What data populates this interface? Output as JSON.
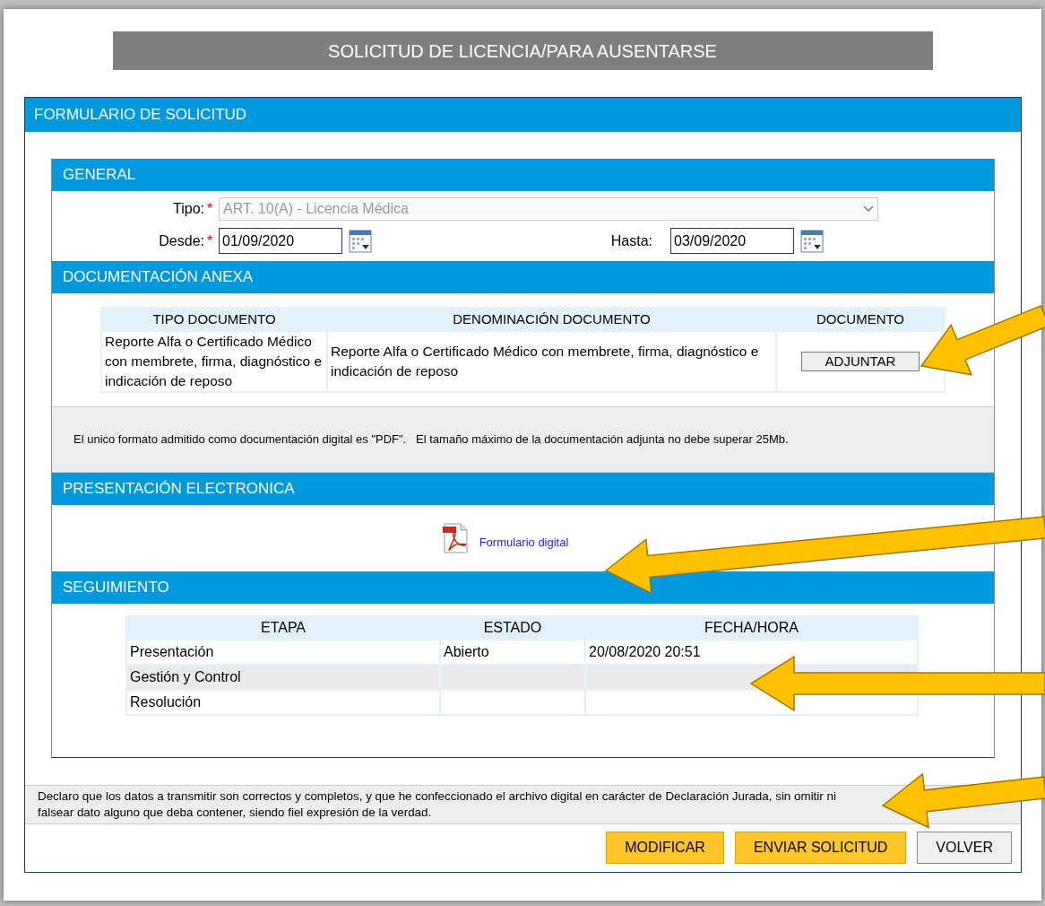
{
  "title": "SOLICITUD DE LICENCIA/PARA AUSENTARSE",
  "form_header": "FORMULARIO DE SOLICITUD",
  "general": {
    "header": "GENERAL",
    "required_marker": "*",
    "tipo": {
      "label": "Tipo:",
      "required": true,
      "value": "ART. 10(A) - Licencia Médica",
      "disabled": true
    },
    "desde": {
      "label": "Desde:",
      "required": true,
      "value": "01/09/2020"
    },
    "hasta": {
      "label": "Hasta:",
      "required": false,
      "value": "03/09/2020"
    }
  },
  "documentacion": {
    "header": "DOCUMENTACIÓN ANEXA",
    "columns": [
      "TIPO DOCUMENTO",
      "DENOMINACIÓN DOCUMENTO",
      "DOCUMENTO"
    ],
    "rows": [
      {
        "tipo": "Reporte Alfa o Certificado Médico con membrete, firma, diagnóstico e indicación de reposo",
        "denominacion": "Reporte Alfa o Certificado Médico con membrete, firma, diagnóstico e indicación de reposo",
        "button": "ADJUNTAR"
      }
    ],
    "note": "El unico formato admitido como documentación digital es \"PDF\".   El tamaño máximo de la documentación adjunta no debe superar 25Mb."
  },
  "presentacion": {
    "header": "PRESENTACIÓN ELECTRONICA",
    "link": "Formulario digital"
  },
  "seguimiento": {
    "header": "SEGUIMIENTO",
    "columns": [
      "ETAPA",
      "ESTADO",
      "FECHA/HORA"
    ],
    "rows": [
      [
        "Presentación",
        "Abierto",
        "20/08/2020 20:51"
      ],
      [
        "Gestión y Control",
        "",
        ""
      ],
      [
        "Resolución",
        "",
        ""
      ]
    ]
  },
  "declaration": "Declaro que los datos a transmitir son correctos y completos, y que he confeccionado el archivo digital en carácter de Declaración Jurada, sin omitir ni falsear dato alguno que deba contener, siendo fiel expresión de la verdad.",
  "buttons": [
    {
      "label": "MODIFICAR",
      "kind": "primary"
    },
    {
      "label": "ENVIAR SOLICITUD",
      "kind": "primary"
    },
    {
      "label": "VOLVER",
      "kind": "secondary"
    }
  ]
}
